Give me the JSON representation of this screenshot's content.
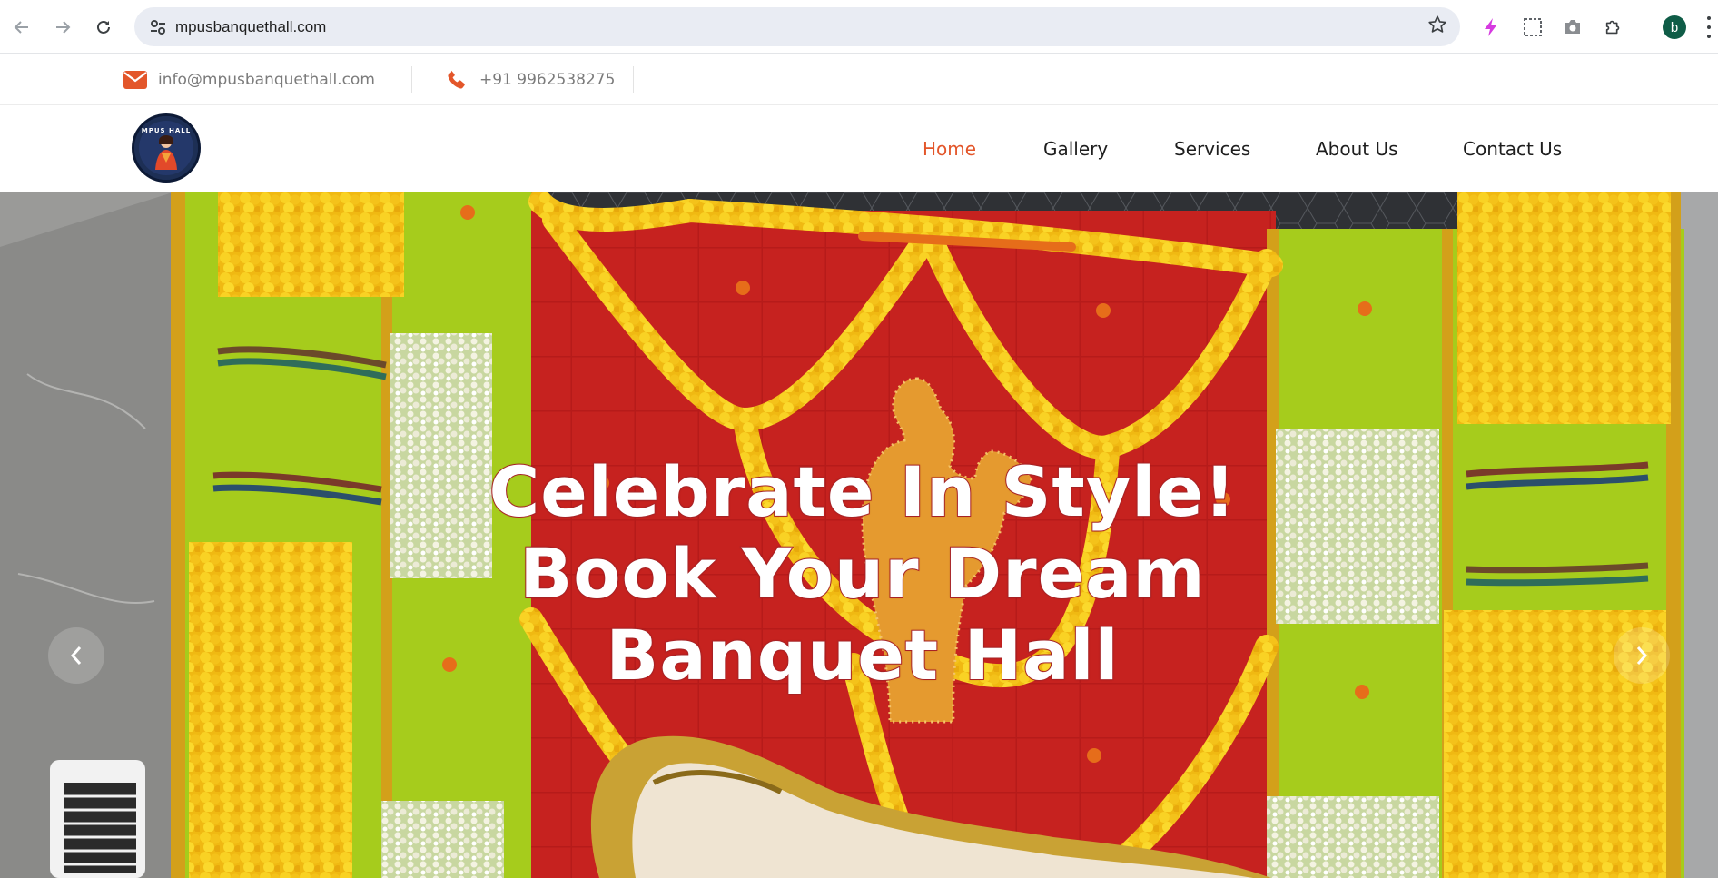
{
  "browser": {
    "url": "mpusbanquethall.com",
    "profile_initial": "b",
    "icons": {
      "back": "arrow-left-icon",
      "forward": "arrow-right-icon",
      "reload": "reload-icon",
      "site_info": "tune-icon",
      "bookmark": "star-icon",
      "ext_lightning": "lightning-icon",
      "ext_screenshot": "screenshot-icon",
      "ext_camera": "camera-icon",
      "extensions": "puzzle-icon",
      "menu": "kebab-icon"
    }
  },
  "topbar": {
    "email": "info@mpusbanquethall.com",
    "phone": "+91 9962538275"
  },
  "header": {
    "logo_text": "MPUS HALL",
    "nav": [
      {
        "label": "Home",
        "active": true
      },
      {
        "label": "Gallery",
        "active": false
      },
      {
        "label": "Services",
        "active": false
      },
      {
        "label": "About Us",
        "active": false
      },
      {
        "label": "Contact Us",
        "active": false
      }
    ]
  },
  "hero": {
    "title_lines": [
      "Celebrate In Style!",
      "Book Your Dream",
      "Banquet Hall"
    ]
  },
  "colors": {
    "accent": "#e3562a",
    "nav_text": "#1e1e1e",
    "contact_text": "#7b7b7b",
    "stage_red": "#c6221f",
    "marigold": "#f4c21a",
    "panel_green": "#a6cc1c"
  }
}
